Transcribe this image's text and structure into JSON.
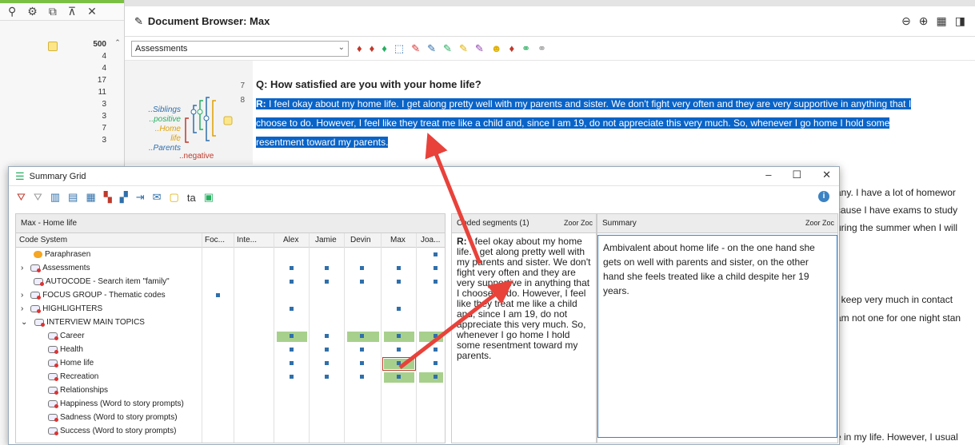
{
  "left": {
    "counts": [
      "500",
      "4",
      "4",
      "17",
      "11",
      "3",
      "3",
      "7",
      "3"
    ]
  },
  "doc": {
    "title": "Document Browser: Max",
    "select_value": "Assessments",
    "line_numbers": [
      "7",
      "8"
    ],
    "bracket_labels": [
      "..Siblings",
      "..positive",
      "..Home life",
      "..Parents"
    ],
    "negative_label": "..negative",
    "question": "Q: How satisfied are you with your home life?",
    "resp_prefix": "R:",
    "resp_line1": " I feel okay about my home life. I get along pretty well with my parents and sister. We don't fight very often and they are very supportive in anything that I",
    "resp_line2": "choose to do. However, I feel like they treat me like a child and, since I am 19, do not appreciate this very much. So, whenever I go home I hold some",
    "resp_line3": "resentment toward my parents.",
    "peeks": [
      "any. I have a lot of homewor",
      "cause I have exams to study",
      "uring the summer when I will",
      "t keep very much in contact",
      "am not one for one night stan",
      "e in my life. However, I usual"
    ]
  },
  "grid": {
    "window_title": "Summary Grid",
    "pane_title": "Max - Home life",
    "columns": [
      "Code System",
      "Foc...",
      "Inte...",
      "Alex",
      "Jamie",
      "Devin",
      "Max",
      "Joa..."
    ],
    "rows": [
      {
        "label": "Paraphrasen"
      },
      {
        "label": "Assessments"
      },
      {
        "label": "AUTOCODE - Search item \"family\""
      },
      {
        "label": "FOCUS GROUP - Thematic codes"
      },
      {
        "label": "HIGHLIGHTERS"
      },
      {
        "label": "INTERVIEW MAIN TOPICS"
      },
      {
        "label": "Career"
      },
      {
        "label": "Health"
      },
      {
        "label": "Home life"
      },
      {
        "label": "Recreation"
      },
      {
        "label": "Relationships"
      },
      {
        "label": "Happiness (Word to story prompts)"
      },
      {
        "label": "Sadness (Word to story prompts)"
      },
      {
        "label": "Success (Word to story prompts)"
      }
    ],
    "seg_header": "Coded segments (1)",
    "zoom_label": "Zoor Zoc",
    "seg_prefix": "R:",
    "seg_text": " I feel okay about my home life. I get along pretty well with my parents and sister. We don't fight very often and they are very supportive in anything that I choose to do. However, I feel like they treat me like a child and, since I am 19, do not appreciate this very much. So, whenever I go home I hold some resentment toward my parents.",
    "sum_header": "Summary",
    "sum_text": "Ambivalent about home life - on the one hand she gets on well with parents and sister, on the other hand she feels treated like a child despite her 19 years."
  }
}
